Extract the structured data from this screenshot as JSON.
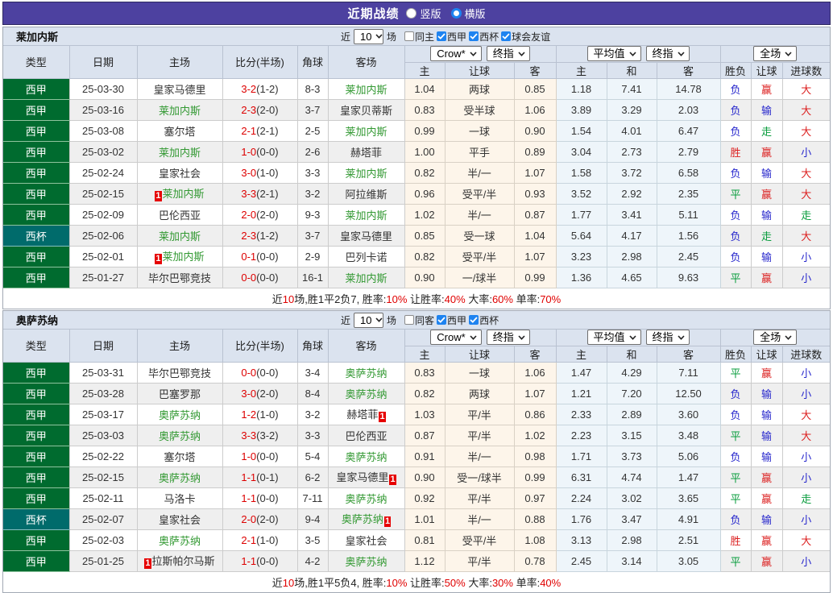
{
  "title_bar": {
    "title": "近期战绩",
    "options": [
      {
        "label": "竖版",
        "selected": false
      },
      {
        "label": "横版",
        "selected": true
      }
    ]
  },
  "table_header": {
    "cols": [
      "类型",
      "日期",
      "主场",
      "比分(半场)",
      "角球",
      "客场"
    ],
    "groups": [
      {
        "selects": [
          "Crow*",
          "终指"
        ]
      },
      {
        "selects": [
          "平均值",
          "终指"
        ]
      },
      {
        "selects": [
          "全场"
        ]
      }
    ],
    "sub_cols": [
      "主",
      "让球",
      "客",
      "主",
      "和",
      "客",
      "胜负",
      "让球",
      "进球数"
    ]
  },
  "colors": {
    "accent_purple": "#4D41A0",
    "league_green": "#006B2F",
    "cup_teal": "#006B6B",
    "focal_team_green": "#339933",
    "score_red": "#DD0000",
    "result_red": "#DC2020",
    "result_blue": "#2626CC",
    "result_green": "#089C3C",
    "checkbox_blue": "#1E83F0"
  },
  "teams": [
    {
      "name": "莱加内斯",
      "toolbar": {
        "prefix": "近",
        "count": "10",
        "suffix": "场",
        "venue_filter": {
          "label": "同主",
          "checked": false
        },
        "league_filters": [
          {
            "label": "西甲",
            "checked": true
          },
          {
            "label": "西杯",
            "checked": true
          },
          {
            "label": "球会友谊",
            "checked": true
          }
        ]
      },
      "rows": [
        {
          "type": "西甲",
          "cup": false,
          "date": "25-03-30",
          "home": {
            "name": "皇家马德里"
          },
          "away": {
            "name": "莱加内斯",
            "focal": true
          },
          "score": "3-2",
          "half": "(1-2)",
          "corners": "8-3",
          "odds": [
            "1.04",
            "两球",
            "0.85"
          ],
          "avg": [
            "1.18",
            "7.41",
            "14.78"
          ],
          "results": [
            {
              "text": "负",
              "color": "blue"
            },
            {
              "text": "赢",
              "color": "red"
            },
            {
              "text": "大",
              "color": "red"
            }
          ]
        },
        {
          "type": "西甲",
          "cup": false,
          "date": "25-03-16",
          "home": {
            "name": "莱加内斯",
            "focal": true
          },
          "away": {
            "name": "皇家贝蒂斯"
          },
          "score": "2-3",
          "half": "(2-0)",
          "corners": "3-7",
          "odds": [
            "0.83",
            "受半球",
            "1.06"
          ],
          "avg": [
            "3.89",
            "3.29",
            "2.03"
          ],
          "results": [
            {
              "text": "负",
              "color": "blue"
            },
            {
              "text": "输",
              "color": "blue"
            },
            {
              "text": "大",
              "color": "red"
            }
          ]
        },
        {
          "type": "西甲",
          "cup": false,
          "date": "25-03-08",
          "home": {
            "name": "塞尔塔"
          },
          "away": {
            "name": "莱加内斯",
            "focal": true
          },
          "score": "2-1",
          "half": "(2-1)",
          "corners": "2-5",
          "odds": [
            "0.99",
            "一球",
            "0.90"
          ],
          "avg": [
            "1.54",
            "4.01",
            "6.47"
          ],
          "results": [
            {
              "text": "负",
              "color": "blue"
            },
            {
              "text": "走",
              "color": "green"
            },
            {
              "text": "大",
              "color": "red"
            }
          ]
        },
        {
          "type": "西甲",
          "cup": false,
          "date": "25-03-02",
          "home": {
            "name": "莱加内斯",
            "focal": true
          },
          "away": {
            "name": "赫塔菲"
          },
          "score": "1-0",
          "half": "(0-0)",
          "corners": "2-6",
          "odds": [
            "1.00",
            "平手",
            "0.89"
          ],
          "avg": [
            "3.04",
            "2.73",
            "2.79"
          ],
          "results": [
            {
              "text": "胜",
              "color": "red"
            },
            {
              "text": "赢",
              "color": "red"
            },
            {
              "text": "小",
              "color": "blue"
            }
          ]
        },
        {
          "type": "西甲",
          "cup": false,
          "date": "25-02-24",
          "home": {
            "name": "皇家社会"
          },
          "away": {
            "name": "莱加内斯",
            "focal": true
          },
          "score": "3-0",
          "half": "(1-0)",
          "corners": "3-3",
          "odds": [
            "0.82",
            "半/一",
            "1.07"
          ],
          "avg": [
            "1.58",
            "3.72",
            "6.58"
          ],
          "results": [
            {
              "text": "负",
              "color": "blue"
            },
            {
              "text": "输",
              "color": "blue"
            },
            {
              "text": "大",
              "color": "red"
            }
          ]
        },
        {
          "type": "西甲",
          "cup": false,
          "date": "25-02-15",
          "home": {
            "name": "莱加内斯",
            "focal": true,
            "red_before": "1"
          },
          "away": {
            "name": "阿拉维斯"
          },
          "score": "3-3",
          "half": "(2-1)",
          "corners": "3-2",
          "odds": [
            "0.96",
            "受平/半",
            "0.93"
          ],
          "avg": [
            "3.52",
            "2.92",
            "2.35"
          ],
          "results": [
            {
              "text": "平",
              "color": "green"
            },
            {
              "text": "赢",
              "color": "red"
            },
            {
              "text": "大",
              "color": "red"
            }
          ]
        },
        {
          "type": "西甲",
          "cup": false,
          "date": "25-02-09",
          "home": {
            "name": "巴伦西亚"
          },
          "away": {
            "name": "莱加内斯",
            "focal": true
          },
          "score": "2-0",
          "half": "(2-0)",
          "corners": "9-3",
          "odds": [
            "1.02",
            "半/一",
            "0.87"
          ],
          "avg": [
            "1.77",
            "3.41",
            "5.11"
          ],
          "results": [
            {
              "text": "负",
              "color": "blue"
            },
            {
              "text": "输",
              "color": "blue"
            },
            {
              "text": "走",
              "color": "green"
            }
          ]
        },
        {
          "type": "西杯",
          "cup": true,
          "date": "25-02-06",
          "home": {
            "name": "莱加内斯",
            "focal": true
          },
          "away": {
            "name": "皇家马德里"
          },
          "score": "2-3",
          "half": "(1-2)",
          "corners": "3-7",
          "odds": [
            "0.85",
            "受一球",
            "1.04"
          ],
          "avg": [
            "5.64",
            "4.17",
            "1.56"
          ],
          "results": [
            {
              "text": "负",
              "color": "blue"
            },
            {
              "text": "走",
              "color": "green"
            },
            {
              "text": "大",
              "color": "red"
            }
          ]
        },
        {
          "type": "西甲",
          "cup": false,
          "date": "25-02-01",
          "home": {
            "name": "莱加内斯",
            "focal": true,
            "red_before": "1"
          },
          "away": {
            "name": "巴列卡诺"
          },
          "score": "0-1",
          "half": "(0-0)",
          "corners": "2-9",
          "odds": [
            "0.82",
            "受平/半",
            "1.07"
          ],
          "avg": [
            "3.23",
            "2.98",
            "2.45"
          ],
          "results": [
            {
              "text": "负",
              "color": "blue"
            },
            {
              "text": "输",
              "color": "blue"
            },
            {
              "text": "小",
              "color": "blue"
            }
          ]
        },
        {
          "type": "西甲",
          "cup": false,
          "date": "25-01-27",
          "home": {
            "name": "毕尔巴鄂竞技"
          },
          "away": {
            "name": "莱加内斯",
            "focal": true
          },
          "score": "0-0",
          "half": "(0-0)",
          "corners": "16-1",
          "odds": [
            "0.90",
            "一/球半",
            "0.99"
          ],
          "avg": [
            "1.36",
            "4.65",
            "9.63"
          ],
          "results": [
            {
              "text": "平",
              "color": "green"
            },
            {
              "text": "赢",
              "color": "red"
            },
            {
              "text": "小",
              "color": "blue"
            }
          ]
        }
      ],
      "summary": [
        {
          "text": "近",
          "red": false
        },
        {
          "text": "10",
          "red": true
        },
        {
          "text": "场,胜1平2负7, 胜率:",
          "red": false
        },
        {
          "text": "10%",
          "red": true
        },
        {
          "text": " 让胜率:",
          "red": false
        },
        {
          "text": "40%",
          "red": true
        },
        {
          "text": " 大率:",
          "red": false
        },
        {
          "text": "60%",
          "red": true
        },
        {
          "text": " 单率:",
          "red": false
        },
        {
          "text": "70%",
          "red": true
        }
      ]
    },
    {
      "name": "奥萨苏纳",
      "toolbar": {
        "prefix": "近",
        "count": "10",
        "suffix": "场",
        "venue_filter": {
          "label": "同客",
          "checked": false
        },
        "league_filters": [
          {
            "label": "西甲",
            "checked": true
          },
          {
            "label": "西杯",
            "checked": true
          }
        ]
      },
      "rows": [
        {
          "type": "西甲",
          "cup": false,
          "date": "25-03-31",
          "home": {
            "name": "毕尔巴鄂竞技"
          },
          "away": {
            "name": "奥萨苏纳",
            "focal": true
          },
          "score": "0-0",
          "half": "(0-0)",
          "corners": "3-4",
          "odds": [
            "0.83",
            "一球",
            "1.06"
          ],
          "avg": [
            "1.47",
            "4.29",
            "7.11"
          ],
          "results": [
            {
              "text": "平",
              "color": "green"
            },
            {
              "text": "赢",
              "color": "red"
            },
            {
              "text": "小",
              "color": "blue"
            }
          ]
        },
        {
          "type": "西甲",
          "cup": false,
          "date": "25-03-28",
          "home": {
            "name": "巴塞罗那"
          },
          "away": {
            "name": "奥萨苏纳",
            "focal": true
          },
          "score": "3-0",
          "half": "(2-0)",
          "corners": "8-4",
          "odds": [
            "0.82",
            "两球",
            "1.07"
          ],
          "avg": [
            "1.21",
            "7.20",
            "12.50"
          ],
          "results": [
            {
              "text": "负",
              "color": "blue"
            },
            {
              "text": "输",
              "color": "blue"
            },
            {
              "text": "小",
              "color": "blue"
            }
          ]
        },
        {
          "type": "西甲",
          "cup": false,
          "date": "25-03-17",
          "home": {
            "name": "奥萨苏纳",
            "focal": true
          },
          "away": {
            "name": "赫塔菲",
            "red_after": "1"
          },
          "score": "1-2",
          "half": "(1-0)",
          "corners": "3-2",
          "odds": [
            "1.03",
            "平/半",
            "0.86"
          ],
          "avg": [
            "2.33",
            "2.89",
            "3.60"
          ],
          "results": [
            {
              "text": "负",
              "color": "blue"
            },
            {
              "text": "输",
              "color": "blue"
            },
            {
              "text": "大",
              "color": "red"
            }
          ]
        },
        {
          "type": "西甲",
          "cup": false,
          "date": "25-03-03",
          "home": {
            "name": "奥萨苏纳",
            "focal": true
          },
          "away": {
            "name": "巴伦西亚"
          },
          "score": "3-3",
          "half": "(3-2)",
          "corners": "3-3",
          "odds": [
            "0.87",
            "平/半",
            "1.02"
          ],
          "avg": [
            "2.23",
            "3.15",
            "3.48"
          ],
          "results": [
            {
              "text": "平",
              "color": "green"
            },
            {
              "text": "输",
              "color": "blue"
            },
            {
              "text": "大",
              "color": "red"
            }
          ]
        },
        {
          "type": "西甲",
          "cup": false,
          "date": "25-02-22",
          "home": {
            "name": "塞尔塔"
          },
          "away": {
            "name": "奥萨苏纳",
            "focal": true
          },
          "score": "1-0",
          "half": "(0-0)",
          "corners": "5-4",
          "odds": [
            "0.91",
            "半/一",
            "0.98"
          ],
          "avg": [
            "1.71",
            "3.73",
            "5.06"
          ],
          "results": [
            {
              "text": "负",
              "color": "blue"
            },
            {
              "text": "输",
              "color": "blue"
            },
            {
              "text": "小",
              "color": "blue"
            }
          ]
        },
        {
          "type": "西甲",
          "cup": false,
          "date": "25-02-15",
          "home": {
            "name": "奥萨苏纳",
            "focal": true
          },
          "away": {
            "name": "皇家马德里",
            "red_after": "1"
          },
          "score": "1-1",
          "half": "(0-1)",
          "corners": "6-2",
          "odds": [
            "0.90",
            "受一/球半",
            "0.99"
          ],
          "avg": [
            "6.31",
            "4.74",
            "1.47"
          ],
          "results": [
            {
              "text": "平",
              "color": "green"
            },
            {
              "text": "赢",
              "color": "red"
            },
            {
              "text": "小",
              "color": "blue"
            }
          ]
        },
        {
          "type": "西甲",
          "cup": false,
          "date": "25-02-11",
          "home": {
            "name": "马洛卡"
          },
          "away": {
            "name": "奥萨苏纳",
            "focal": true
          },
          "score": "1-1",
          "half": "(0-0)",
          "corners": "7-11",
          "odds": [
            "0.92",
            "平/半",
            "0.97"
          ],
          "avg": [
            "2.24",
            "3.02",
            "3.65"
          ],
          "results": [
            {
              "text": "平",
              "color": "green"
            },
            {
              "text": "赢",
              "color": "red"
            },
            {
              "text": "走",
              "color": "green"
            }
          ]
        },
        {
          "type": "西杯",
          "cup": true,
          "date": "25-02-07",
          "home": {
            "name": "皇家社会"
          },
          "away": {
            "name": "奥萨苏纳",
            "focal": true,
            "red_after": "1"
          },
          "score": "2-0",
          "half": "(2-0)",
          "corners": "9-4",
          "odds": [
            "1.01",
            "半/一",
            "0.88"
          ],
          "avg": [
            "1.76",
            "3.47",
            "4.91"
          ],
          "results": [
            {
              "text": "负",
              "color": "blue"
            },
            {
              "text": "输",
              "color": "blue"
            },
            {
              "text": "小",
              "color": "blue"
            }
          ]
        },
        {
          "type": "西甲",
          "cup": false,
          "date": "25-02-03",
          "home": {
            "name": "奥萨苏纳",
            "focal": true
          },
          "away": {
            "name": "皇家社会"
          },
          "score": "2-1",
          "half": "(1-0)",
          "corners": "3-5",
          "odds": [
            "0.81",
            "受平/半",
            "1.08"
          ],
          "avg": [
            "3.13",
            "2.98",
            "2.51"
          ],
          "results": [
            {
              "text": "胜",
              "color": "red"
            },
            {
              "text": "赢",
              "color": "red"
            },
            {
              "text": "大",
              "color": "red"
            }
          ]
        },
        {
          "type": "西甲",
          "cup": false,
          "date": "25-01-25",
          "home": {
            "name": "拉斯帕尔马斯",
            "red_before": "1"
          },
          "away": {
            "name": "奥萨苏纳",
            "focal": true
          },
          "score": "1-1",
          "half": "(0-0)",
          "corners": "4-2",
          "odds": [
            "1.12",
            "平/半",
            "0.78"
          ],
          "avg": [
            "2.45",
            "3.14",
            "3.05"
          ],
          "results": [
            {
              "text": "平",
              "color": "green"
            },
            {
              "text": "赢",
              "color": "red"
            },
            {
              "text": "小",
              "color": "blue"
            }
          ]
        }
      ],
      "summary": [
        {
          "text": "近",
          "red": false
        },
        {
          "text": "10",
          "red": true
        },
        {
          "text": "场,胜1平5负4, 胜率:",
          "red": false
        },
        {
          "text": "10%",
          "red": true
        },
        {
          "text": " 让胜率:",
          "red": false
        },
        {
          "text": "50%",
          "red": true
        },
        {
          "text": " 大率:",
          "red": false
        },
        {
          "text": "30%",
          "red": true
        },
        {
          "text": " 单率:",
          "red": false
        },
        {
          "text": "40%",
          "red": true
        }
      ]
    }
  ]
}
